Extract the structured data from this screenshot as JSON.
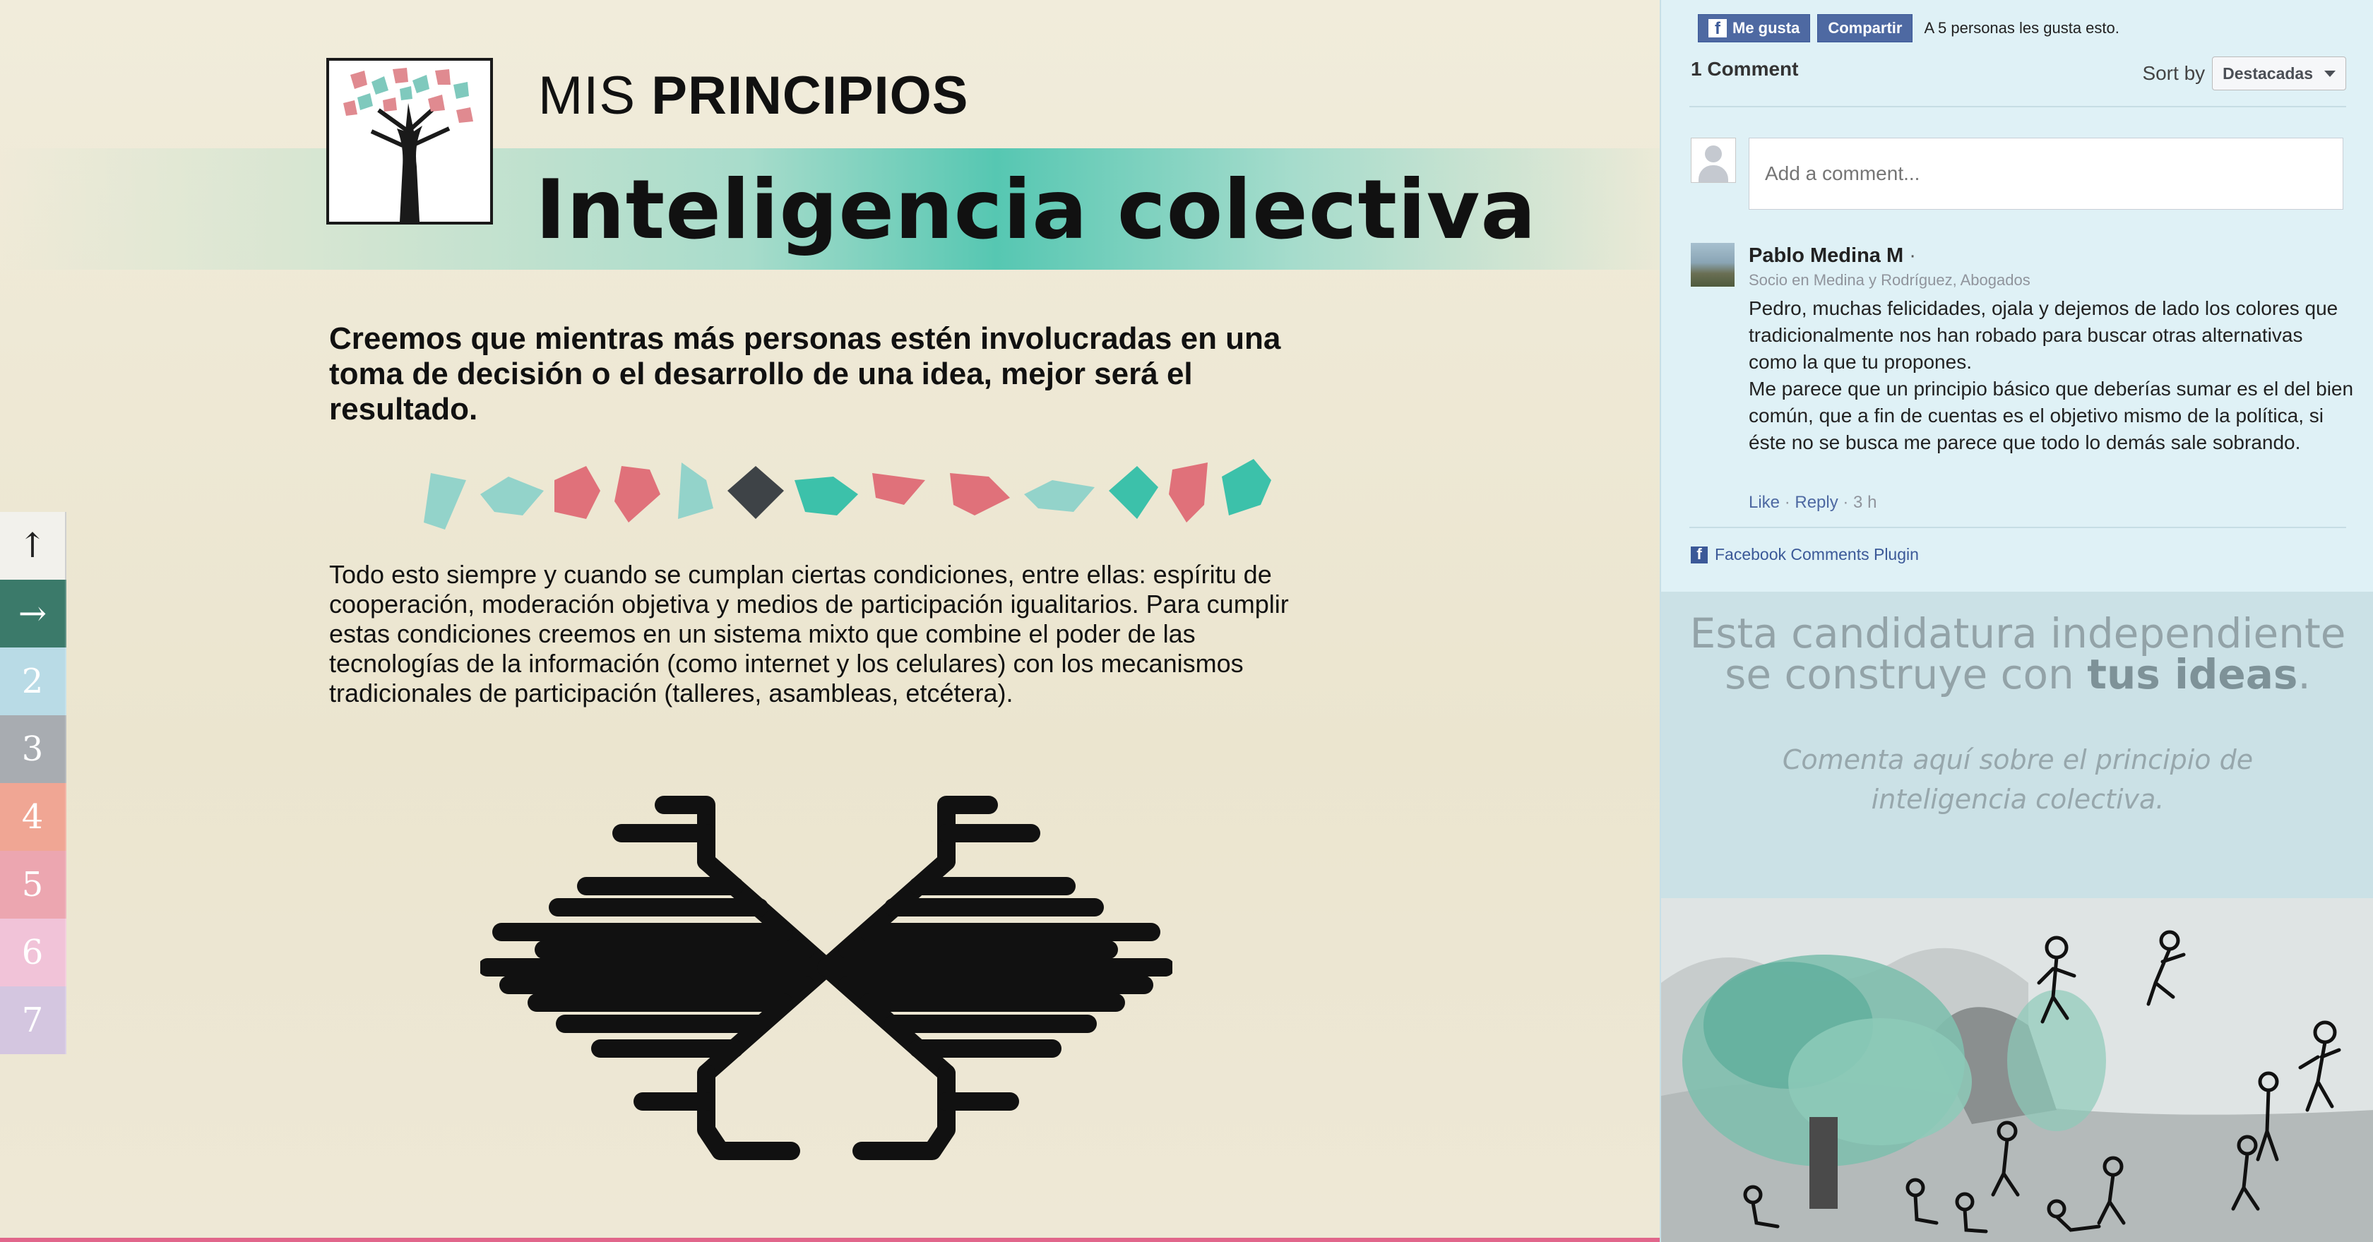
{
  "header": {
    "kicker_light": "MIS",
    "kicker_bold": "PRINCIPIOS",
    "title": "Inteligencia colectiva"
  },
  "content": {
    "lead": "Creemos que mientras más personas estén involucradas en una toma de decisión o el desarrollo de una idea, mejor será el resultado.",
    "body": "Todo esto siempre y cuando se cumplan ciertas condiciones, entre ellas: espíritu de cooperación, moderación objetiva y medios de participación igualitarios. Para cumplir estas condiciones creemos en un sistema mixto que combine el poder de las tecnologías de la información (como internet y los celulares) con los mecanismos tradicionales de participación (talleres, asambleas, etcétera)."
  },
  "stepnav": {
    "up": "↑",
    "forward": "→",
    "steps": [
      "2",
      "3",
      "4",
      "5",
      "6",
      "7"
    ]
  },
  "facebook": {
    "like_label": "Me gusta",
    "share_label": "Compartir",
    "like_count_text": "A 5 personas les gusta esto.",
    "comments_count": "1 Comment",
    "sort_label": "Sort by",
    "sort_value": "Destacadas",
    "input_placeholder": "Add a comment...",
    "comment": {
      "author": "Pablo Medina M",
      "author_suffix": "·",
      "meta": "Socio en Medina y Rodríguez, Abogados",
      "paragraphs": [
        "Pedro, muchas felicidades, ojala y dejemos de lado los colores que tradicionalmente nos han robado para buscar otras alternativas como la que tu propones.",
        "Me parece que un principio básico que deberías sumar es el del bien común, que a fin de cuentas es el objetivo mismo de la política, si éste no se busca me parece que todo lo demás sale sobrando."
      ],
      "like": "Like",
      "sep1": " · ",
      "reply": "Reply",
      "sep2": " · ",
      "time": "3 h"
    },
    "plugin_label": "Facebook Comments Plugin"
  },
  "promo": {
    "line1": "Esta candidatura independiente",
    "line2_pre": "se construye con ",
    "line2_bold": "tus ideas",
    "line2_post": ".",
    "italic_line1": "Comenta aquí sobre el principio de",
    "italic_line2": "inteligencia colectiva."
  },
  "colors": {
    "teal": "#3cc1aa",
    "light_teal": "#93d3ca",
    "coral": "#e0717a",
    "dark": "#3e4347",
    "fb_blue": "#4e69a2",
    "accent_bar": "#e1668b"
  },
  "icons": {
    "up": "arrow-up-icon",
    "forward": "arrow-right-icon",
    "facebook": "facebook-icon"
  }
}
